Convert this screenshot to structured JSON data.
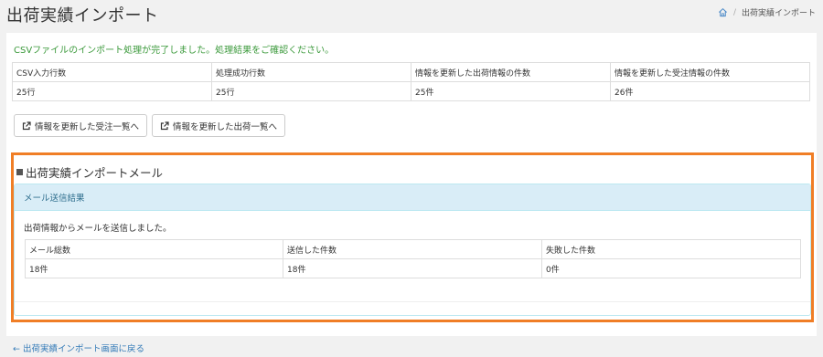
{
  "header": {
    "title": "出荷実績インポート",
    "breadcrumb_current": "出荷実績インポート",
    "breadcrumb_sep": "/"
  },
  "import_result": {
    "message": "CSVファイルのインポート処理が完了しました。処理結果をご確認ください。",
    "columns": [
      "CSV入力行数",
      "処理成功行数",
      "情報を更新した出荷情報の件数",
      "情報を更新した受注情報の件数"
    ],
    "values": [
      "25行",
      "25行",
      "25件",
      "26件"
    ]
  },
  "buttons": {
    "orders_list": "情報を更新した受注一覧へ",
    "shipments_list": "情報を更新した出荷一覧へ"
  },
  "mail_section": {
    "heading": "出荷実績インポートメール",
    "panel_title": "メール送信結果",
    "message": "出荷情報からメールを送信しました。",
    "columns": [
      "メール総数",
      "送信した件数",
      "失敗した件数"
    ],
    "values": [
      "18件",
      "18件",
      "0件"
    ]
  },
  "back_link": "← 出荷実績インポート画面に戻る",
  "colors": {
    "success": "#3c9a3c",
    "link": "#337ab7",
    "highlight": "#f07e26",
    "panel_heading_bg": "#d9edf7"
  }
}
